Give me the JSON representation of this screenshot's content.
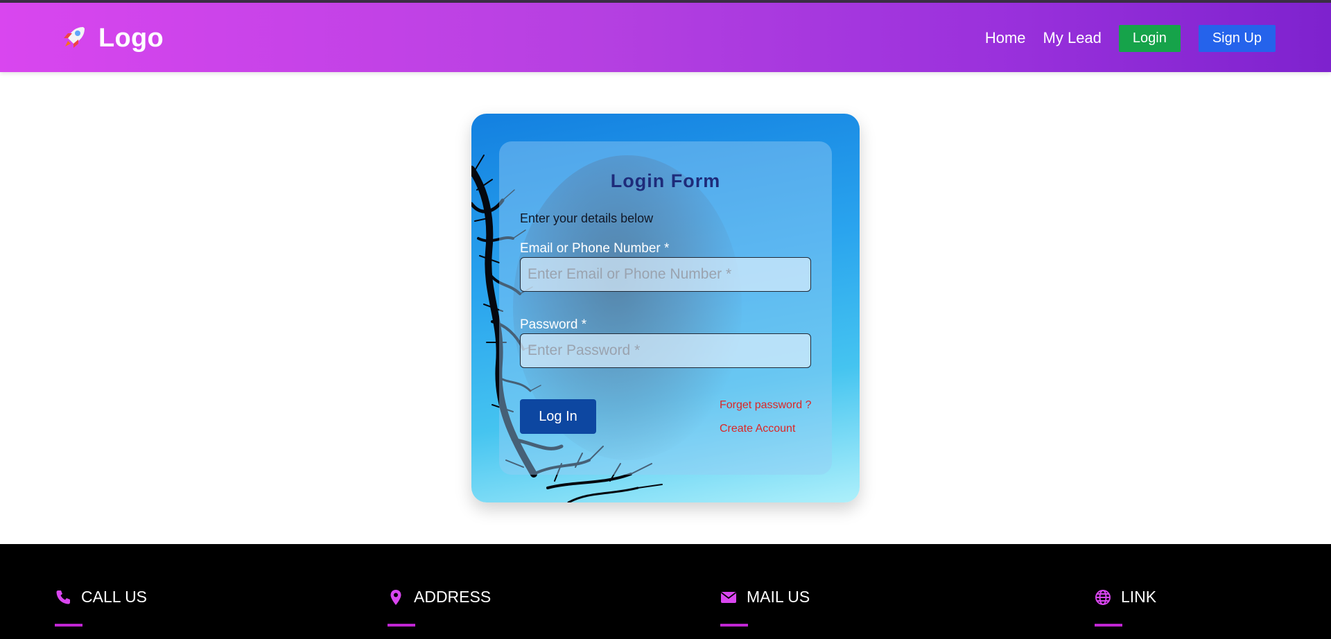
{
  "header": {
    "logo_text": "Logo",
    "nav": {
      "home": "Home",
      "my_lead": "My Lead",
      "login": "Login",
      "signup": "Sign Up"
    }
  },
  "login_form": {
    "title": "Login Form",
    "subtitle": "Enter your details below",
    "email_label": "Email or Phone Number *",
    "email_placeholder": "Enter Email or Phone Number *",
    "email_value": "",
    "password_label": "Password *",
    "password_placeholder": "Enter Password *",
    "password_value": "",
    "submit_label": "Log In",
    "forgot_link": "Forget password ?",
    "create_link": "Create Account"
  },
  "footer": {
    "columns": [
      {
        "title": "CALL US",
        "icon": "phone-icon"
      },
      {
        "title": "ADDRESS",
        "icon": "map-pin-icon"
      },
      {
        "title": "MAIL US",
        "icon": "envelope-icon"
      },
      {
        "title": "LINK",
        "icon": "globe-icon"
      }
    ]
  },
  "colors": {
    "header_gradient_start": "#d946ef",
    "header_gradient_end": "#7e22ce",
    "login_button": "#16a34a",
    "signup_button": "#2563eb",
    "submit_button": "#0d47a1",
    "link_red": "#dc2626",
    "form_title": "#1e2b7a",
    "footer_accent": "#c026d3"
  }
}
